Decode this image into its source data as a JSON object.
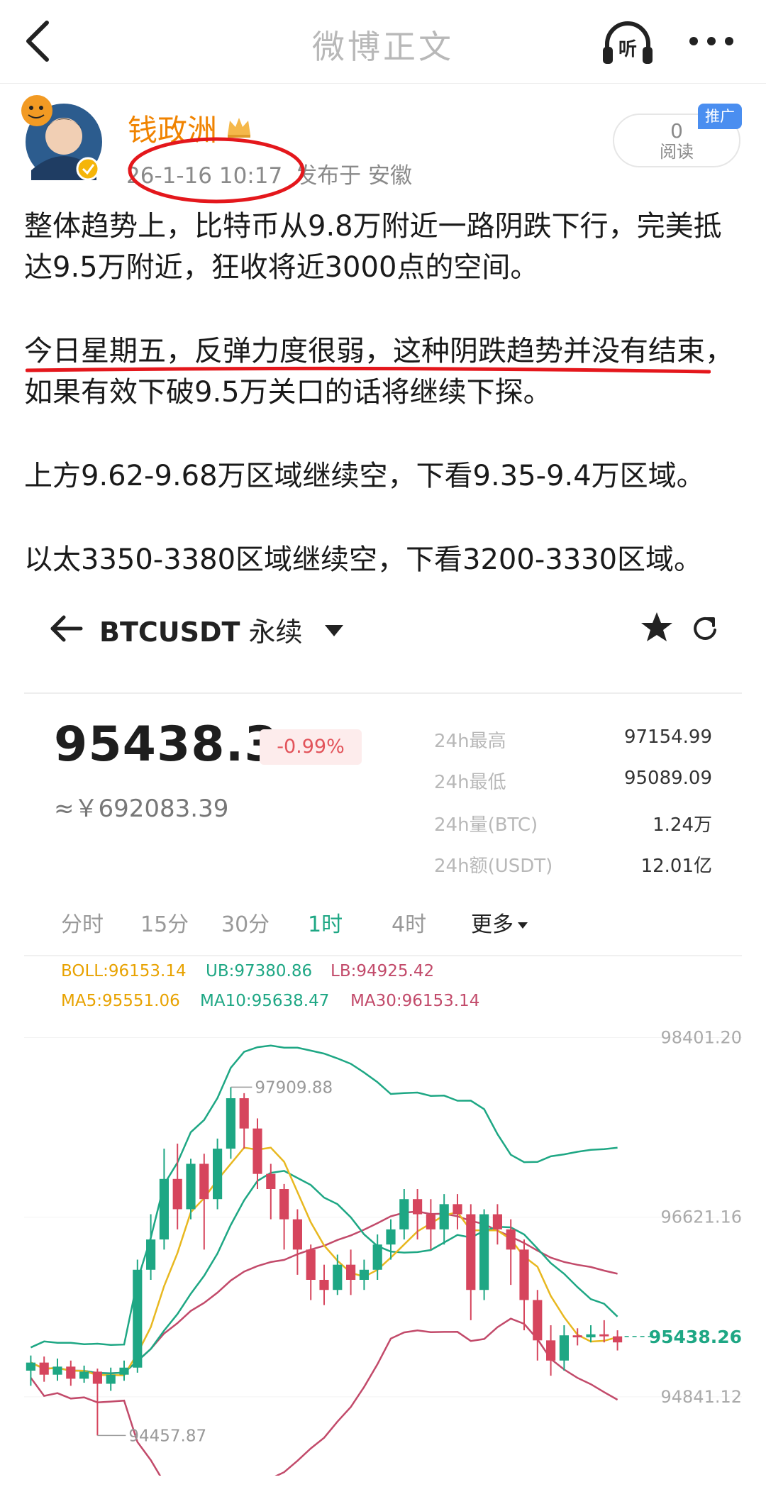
{
  "nav": {
    "title": "微博正文",
    "back_icon": "chevron-left-icon",
    "listen_label": "听",
    "more_icon": "ellipsis-icon"
  },
  "post": {
    "author": "钱政洲",
    "date": "26-1-16 10:17",
    "location": "发布于 安徽",
    "read_count": "0",
    "read_label": "阅读",
    "promo_label": "推广",
    "paragraphs": [
      "整体趋势上，比特币从9.8万附近一路阴跌下行，完美抵达9.5万附近，狂收将近3000点的空间。",
      "今日星期五，反弹力度很弱，这种阴跌趋势并没有结束，如果有效下破9.5万关口的话将继续下探。",
      "上方9.62-9.68万区域继续空，下看9.35-9.4万区域。",
      "以太3350-3380区域继续空，下看3200-3330区域。"
    ],
    "annotation_color": "#e4171c"
  },
  "ticker": {
    "pair": "BTCUSDT",
    "contract": "永续",
    "price": "95438.3",
    "change": "-0.99%",
    "cny": "≈￥692083.39",
    "stats": [
      {
        "label": "24h最高",
        "value": "97154.99"
      },
      {
        "label": "24h最低",
        "value": "95089.09"
      },
      {
        "label": "24h量(BTC)",
        "value": "1.24万"
      },
      {
        "label": "24h额(USDT)",
        "value": "12.01亿"
      }
    ],
    "timeframes": [
      "分时",
      "15分",
      "30分",
      "1时",
      "4时",
      "更多"
    ],
    "active_timeframe": "1时"
  },
  "indicators": {
    "boll": "BOLL:96153.14",
    "ub": "UB:97380.86",
    "lb": "LB:94925.42",
    "ma5": "MA5:95551.06",
    "ma10": "MA10:95638.47",
    "ma30": "MA30:96153.14"
  },
  "chart_data": {
    "type": "candlestick",
    "interval": "1h",
    "y_axis_labels": [
      "98401.20",
      "96621.16",
      "94841.12"
    ],
    "y_range": [
      94200,
      98700
    ],
    "high_annotation": "97909.88",
    "low_annotation": "94457.87",
    "current_price": "95438.26",
    "colors": {
      "up": "#1ea784",
      "down": "#d6455d",
      "ma5": "#e8b820",
      "ma10": "#1ea784",
      "ma30": "#c24a6a"
    },
    "candles": [
      [
        95100,
        95180,
        94950,
        95250
      ],
      [
        95180,
        95060,
        94990,
        95240
      ],
      [
        95060,
        95140,
        95000,
        95220
      ],
      [
        95140,
        95020,
        94950,
        95200
      ],
      [
        95020,
        95090,
        94980,
        95150
      ],
      [
        95090,
        94970,
        94457.87,
        95120
      ],
      [
        94970,
        95060,
        94900,
        95130
      ],
      [
        95060,
        95130,
        95000,
        95200
      ],
      [
        95130,
        96100,
        95080,
        96200
      ],
      [
        96100,
        96400,
        96000,
        96650
      ],
      [
        96400,
        97000,
        96300,
        97300
      ],
      [
        97000,
        96700,
        96500,
        97350
      ],
      [
        96700,
        97150,
        96600,
        97200
      ],
      [
        97150,
        96800,
        96300,
        97250
      ],
      [
        96800,
        97300,
        96700,
        97400
      ],
      [
        97300,
        97800,
        97200,
        97909.88
      ],
      [
        97800,
        97500,
        97300,
        97850
      ],
      [
        97500,
        97050,
        96900,
        97600
      ],
      [
        97050,
        96900,
        96600,
        97150
      ],
      [
        96900,
        96600,
        96300,
        96950
      ],
      [
        96600,
        96300,
        96050,
        96700
      ],
      [
        96300,
        96000,
        95800,
        96350
      ],
      [
        96000,
        95900,
        95750,
        96150
      ],
      [
        95900,
        96150,
        95850,
        96250
      ],
      [
        96150,
        96000,
        95850,
        96300
      ],
      [
        96000,
        96100,
        95900,
        96200
      ],
      [
        96100,
        96350,
        96000,
        96450
      ],
      [
        96350,
        96500,
        96200,
        96600
      ],
      [
        96500,
        96800,
        96400,
        96900
      ],
      [
        96800,
        96650,
        96400,
        96900
      ],
      [
        96650,
        96500,
        96300,
        96800
      ],
      [
        96500,
        96750,
        96350,
        96850
      ],
      [
        96750,
        96650,
        96500,
        96850
      ],
      [
        96650,
        95900,
        95600,
        96750
      ],
      [
        95900,
        96650,
        95800,
        96700
      ],
      [
        96650,
        96500,
        96350,
        96750
      ],
      [
        96500,
        96300,
        95950,
        96600
      ],
      [
        96300,
        95800,
        95500,
        96400
      ],
      [
        95800,
        95400,
        95200,
        95900
      ],
      [
        95400,
        95200,
        95050,
        95550
      ],
      [
        95200,
        95450,
        95100,
        95550
      ],
      [
        95450,
        95430,
        95350,
        95520
      ],
      [
        95430,
        95460,
        95380,
        95550
      ],
      [
        95460,
        95440,
        95380,
        95600
      ],
      [
        95440,
        95380,
        95300,
        95500
      ]
    ]
  }
}
